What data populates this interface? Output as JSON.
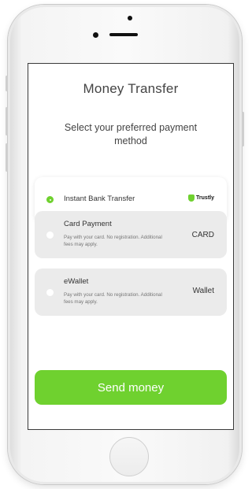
{
  "screen": {
    "title": "Money Transfer",
    "subtitle": "Select your preferred payment method"
  },
  "options": [
    {
      "label": "Instant Bank Transfer",
      "selected": true,
      "brand": "Trustly",
      "brand_icon": "trustly-logo-icon"
    },
    {
      "label": "Card Payment",
      "selected": false,
      "description": "Pay with your card. No registration. Additional fees may apply.",
      "right_label": "CARD"
    },
    {
      "label": "eWallet",
      "selected": false,
      "description": "Pay with your card. No registration. Additional fees may apply.",
      "right_label": "Wallet"
    }
  ],
  "send_button": {
    "label": "Send money"
  },
  "colors": {
    "accent": "#6fd12f",
    "option_bg": "#ebebeb",
    "text": "#444444"
  }
}
